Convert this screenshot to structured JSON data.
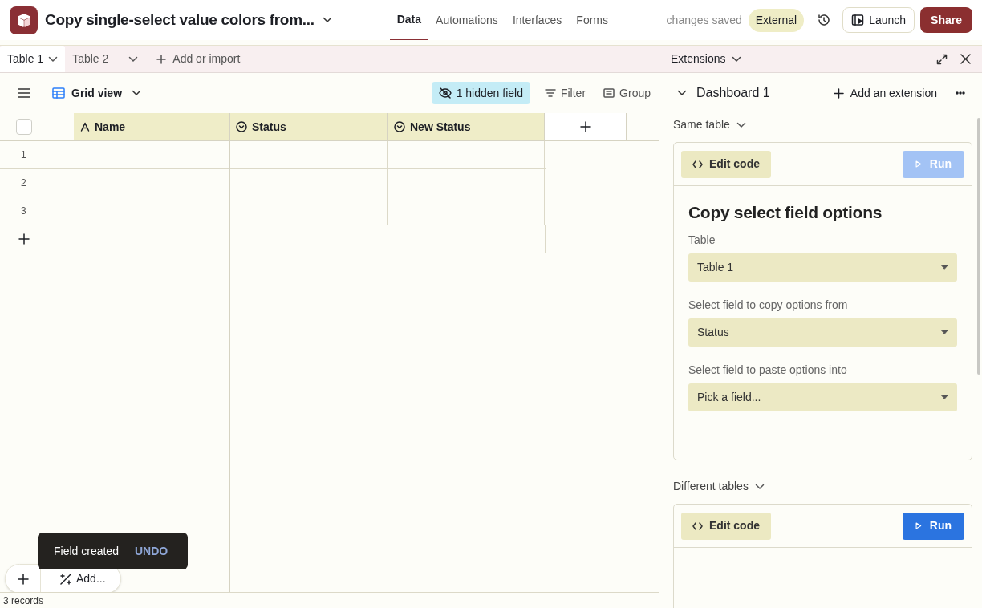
{
  "app": {
    "title": "Copy single-select value colors from...",
    "nav": [
      {
        "label": "Data",
        "selected": true
      },
      {
        "label": "Automations",
        "selected": false
      },
      {
        "label": "Interfaces",
        "selected": false
      },
      {
        "label": "Forms",
        "selected": false
      }
    ],
    "save_status": "changes saved",
    "badge": "External",
    "launch": "Launch",
    "share": "Share"
  },
  "tables": [
    {
      "label": "Table 1",
      "selected": true
    },
    {
      "label": "Table 2",
      "selected": false
    }
  ],
  "add_table": "Add or import",
  "view": {
    "name": "Grid view",
    "hidden_fields": "1 hidden field",
    "filter": "Filter",
    "group": "Group"
  },
  "grid": {
    "columns": [
      {
        "name": "Name",
        "kind": "text"
      },
      {
        "name": "Status",
        "kind": "select"
      },
      {
        "name": "New Status",
        "kind": "select"
      }
    ],
    "rows": [
      "1",
      "2",
      "3"
    ],
    "select_all_checked": false
  },
  "add_menu": "Add...",
  "record_count": "3 records",
  "toast": {
    "message": "Field created",
    "action": "UNDO"
  },
  "extensions": {
    "title": "Extensions",
    "dashboard": "Dashboard 1",
    "add": "Add an extension",
    "sections": [
      {
        "label": "Same table",
        "edit": "Edit code",
        "run": {
          "label": "Run",
          "disabled": true
        },
        "heading": "Copy select field options",
        "fields": [
          {
            "label": "Table",
            "value": "Table 1"
          },
          {
            "label": "Select field to copy options from",
            "value": "Status"
          },
          {
            "label": "Select field to paste options into",
            "value": "Pick a field..."
          }
        ]
      },
      {
        "label": "Different tables",
        "edit": "Edit code",
        "run": {
          "label": "Run",
          "disabled": false
        }
      }
    ]
  }
}
